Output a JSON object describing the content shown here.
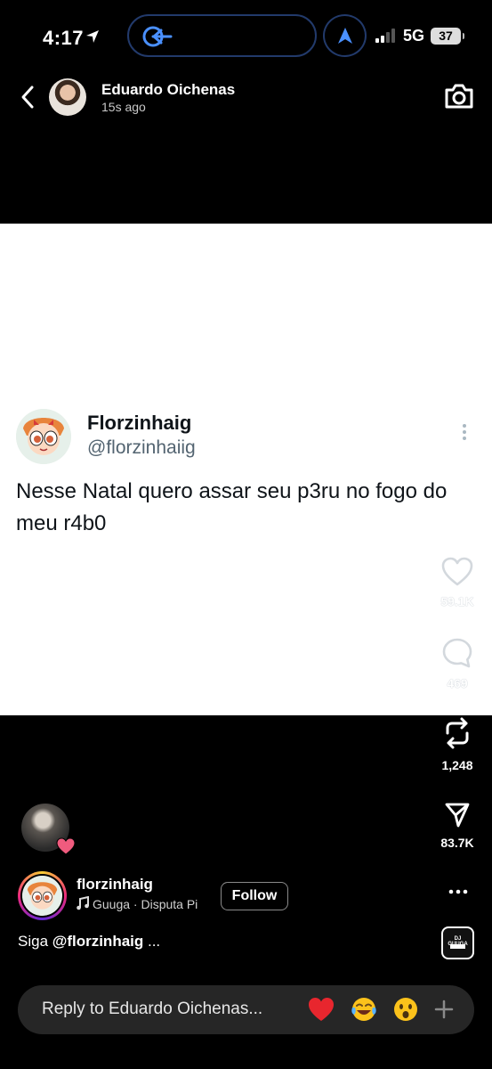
{
  "status_bar": {
    "time": "4:17",
    "network": "5G",
    "battery": "37"
  },
  "header": {
    "author_name": "Eduardo Oichenas",
    "posted_ago": "15s ago"
  },
  "tweet": {
    "display_name": "Florzinhaig",
    "handle": "@florzinhaiig",
    "text": "Nesse Natal quero assar seu p3ru no fogo do meu r4b0"
  },
  "actions": {
    "likes": "59.1K",
    "comments": "469",
    "reposts": "1,248",
    "shares": "83.7K"
  },
  "creator": {
    "username": "florzinhaig",
    "music": "Guuga · Disputa Pi",
    "follow_label": "Follow",
    "caption_prefix": "Siga ",
    "caption_mention": "@florzinhaig",
    "caption_suffix": " ..."
  },
  "audio_thumb": {
    "label": "DJ GUUGA"
  },
  "reply": {
    "placeholder": "Reply to Eduardo Oichenas..."
  },
  "icons": {
    "back": "chevron-left-icon",
    "camera": "camera-icon",
    "like": "heart-icon",
    "comment": "comment-icon",
    "repost": "repost-icon",
    "share": "send-icon",
    "more": "more-icon"
  },
  "colors": {
    "heart": "#e0245e",
    "ring_gradient": [
      "#f9ce34",
      "#ee2a7b",
      "#6228d7"
    ],
    "island_border": "#223a6b",
    "nav_blue": "#4a90ff"
  }
}
